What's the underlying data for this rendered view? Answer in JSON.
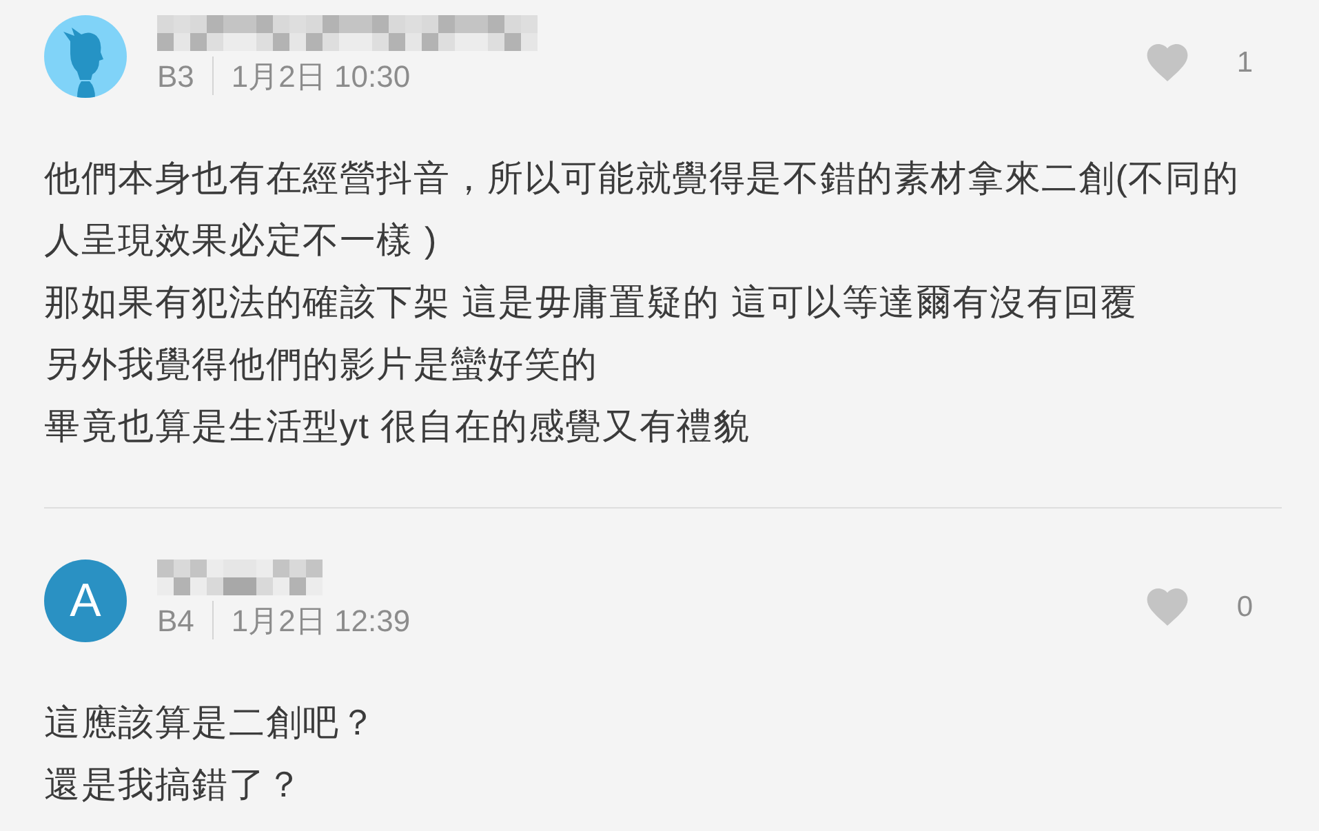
{
  "comments": [
    {
      "avatar": {
        "kind": "silhouette"
      },
      "floor": "B3",
      "time": "1月2日 10:30",
      "likes": {
        "liked": false,
        "count": "1"
      },
      "body": [
        "他們本身也有在經營抖音，所以可能就覺得是不錯的素材拿來二創(不同的人呈現效果必定不一樣 )",
        "那如果有犯法的確該下架 這是毋庸置疑的 這可以等達爾有沒有回覆",
        "另外我覺得他們的影片是蠻好笑的",
        "畢竟也算是生活型yt 很自在的感覺又有禮貌"
      ]
    },
    {
      "avatar": {
        "kind": "letter",
        "letter": "A"
      },
      "floor": "B4",
      "time": "1月2日 12:39",
      "likes": {
        "liked": false,
        "count": "0"
      },
      "body": [
        "這應該算是二創吧？",
        "還是我搞錯了？"
      ]
    }
  ]
}
